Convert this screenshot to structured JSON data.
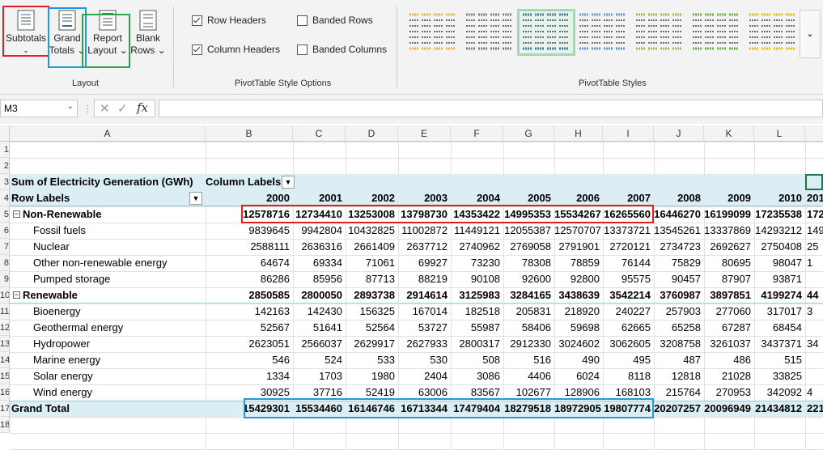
{
  "ribbon": {
    "layout_buttons": [
      {
        "label1": "Subtotals",
        "label2": ""
      },
      {
        "label1": "Grand",
        "label2": "Totals"
      },
      {
        "label1": "Report",
        "label2": "Layout"
      },
      {
        "label1": "Blank",
        "label2": "Rows"
      }
    ],
    "group_layout": "Layout",
    "style_options": {
      "row_headers": "Row Headers",
      "column_headers": "Column Headers",
      "banded_rows": "Banded Rows",
      "banded_columns": "Banded Columns",
      "row_headers_checked": true,
      "column_headers_checked": true,
      "banded_rows_checked": false,
      "banded_columns_checked": false
    },
    "group_style_options": "PivotTable Style Options",
    "group_styles": "PivotTable Styles",
    "swatch_colors": [
      "#f2b544",
      "#7f7f7f",
      "#3a7f9f",
      "#5b9bd5",
      "#9bbb59",
      "#70ad47",
      "#f2c200"
    ]
  },
  "formula_bar": {
    "name_box": "M3",
    "formula": ""
  },
  "columns": [
    "A",
    "B",
    "C",
    "D",
    "E",
    "F",
    "G",
    "H",
    "I",
    "J",
    "K",
    "L"
  ],
  "rows": [
    "1",
    "2",
    "3",
    "4",
    "5",
    "6",
    "7",
    "8",
    "9",
    "10",
    "11",
    "12",
    "13",
    "14",
    "15",
    "16",
    "17",
    "18"
  ],
  "pivot": {
    "title": "Sum of Electricity Generation (GWh)",
    "column_labels": "Column Labels",
    "row_labels": "Row Labels",
    "years": [
      "2000",
      "2001",
      "2002",
      "2003",
      "2004",
      "2005",
      "2006",
      "2007",
      "2008",
      "2009",
      "2010",
      "201"
    ],
    "rows": [
      {
        "label": "Non-Renewable",
        "level": 0,
        "values": [
          "12578716",
          "12734410",
          "13253008",
          "13798730",
          "14353422",
          "14995353",
          "15534267",
          "16265560",
          "16446270",
          "16199099",
          "17235538",
          "172"
        ]
      },
      {
        "label": "Fossil fuels",
        "level": 1,
        "values": [
          "9839645",
          "9942804",
          "10432825",
          "11002872",
          "11449121",
          "12055387",
          "12570707",
          "13373721",
          "13545261",
          "13337869",
          "14293212",
          "149"
        ]
      },
      {
        "label": "Nuclear",
        "level": 1,
        "values": [
          "2588111",
          "2636316",
          "2661409",
          "2637712",
          "2740962",
          "2769058",
          "2791901",
          "2720121",
          "2734723",
          "2692627",
          "2750408",
          "25"
        ]
      },
      {
        "label": "Other non-renewable energy",
        "level": 1,
        "values": [
          "64674",
          "69334",
          "71061",
          "69927",
          "73230",
          "78308",
          "78859",
          "76144",
          "75829",
          "80695",
          "98047",
          "1"
        ]
      },
      {
        "label": "Pumped storage",
        "level": 1,
        "values": [
          "86286",
          "85956",
          "87713",
          "88219",
          "90108",
          "92600",
          "92800",
          "95575",
          "90457",
          "87907",
          "93871",
          ""
        ]
      },
      {
        "label": "Renewable",
        "level": 0,
        "values": [
          "2850585",
          "2800050",
          "2893738",
          "2914614",
          "3125983",
          "3284165",
          "3438639",
          "3542214",
          "3760987",
          "3897851",
          "4199274",
          "44"
        ]
      },
      {
        "label": "Bioenergy",
        "level": 1,
        "values": [
          "142163",
          "142430",
          "156325",
          "167014",
          "182518",
          "205831",
          "218920",
          "240227",
          "257903",
          "277060",
          "317017",
          "3"
        ]
      },
      {
        "label": "Geothermal energy",
        "level": 1,
        "values": [
          "52567",
          "51641",
          "52564",
          "53727",
          "55987",
          "58406",
          "59698",
          "62665",
          "65258",
          "67287",
          "68454",
          ""
        ]
      },
      {
        "label": "Hydropower",
        "level": 1,
        "values": [
          "2623051",
          "2566037",
          "2629917",
          "2627933",
          "2800317",
          "2912330",
          "3024602",
          "3062605",
          "3208758",
          "3261037",
          "3437371",
          "34"
        ]
      },
      {
        "label": "Marine energy",
        "level": 1,
        "values": [
          "546",
          "524",
          "533",
          "530",
          "508",
          "516",
          "490",
          "495",
          "487",
          "486",
          "515",
          ""
        ]
      },
      {
        "label": "Solar energy",
        "level": 1,
        "values": [
          "1334",
          "1703",
          "1980",
          "2404",
          "3086",
          "4406",
          "6024",
          "8118",
          "12818",
          "21028",
          "33825",
          ""
        ]
      },
      {
        "label": "Wind energy",
        "level": 1,
        "values": [
          "30925",
          "37716",
          "52419",
          "63006",
          "83567",
          "102677",
          "128906",
          "168103",
          "215764",
          "270953",
          "342092",
          "4"
        ]
      }
    ],
    "grand_total_label": "Grand Total",
    "grand_total": [
      "15429301",
      "15534460",
      "16146746",
      "16713344",
      "17479404",
      "18279518",
      "18972905",
      "19807774",
      "20207257",
      "20096949",
      "21434812",
      "221"
    ]
  }
}
